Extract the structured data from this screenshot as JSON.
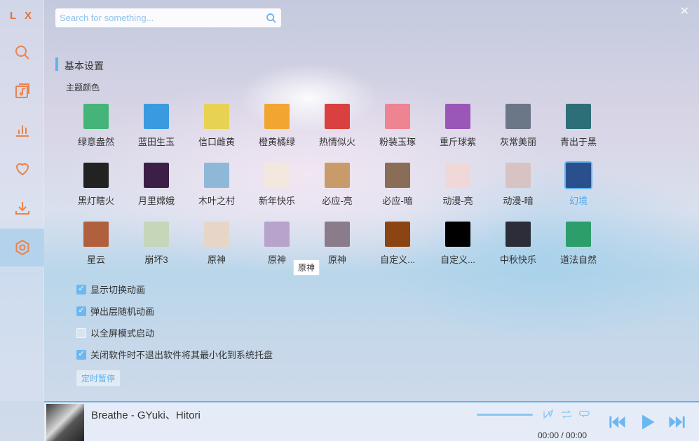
{
  "app": {
    "logo": "L X"
  },
  "sidebar": {
    "items": [
      {
        "name": "search",
        "icon": "search-icon"
      },
      {
        "name": "song-list",
        "icon": "music-list-icon"
      },
      {
        "name": "leaderboard",
        "icon": "chart-icon"
      },
      {
        "name": "favorites",
        "icon": "heart-icon"
      },
      {
        "name": "download",
        "icon": "download-icon"
      },
      {
        "name": "settings",
        "icon": "settings-icon",
        "active": true
      }
    ]
  },
  "search": {
    "placeholder": "Search for something..."
  },
  "settings": {
    "section_title": "基本设置",
    "theme_title": "主题颜色",
    "themes": [
      {
        "label": "绿意盎然",
        "color": "#45b479"
      },
      {
        "label": "蓝田生玉",
        "color": "#3a9ae0"
      },
      {
        "label": "信口雌黄",
        "color": "#e8d252"
      },
      {
        "label": "橙黄橘绿",
        "color": "#f3a532"
      },
      {
        "label": "热情似火",
        "color": "#d9403f"
      },
      {
        "label": "粉装玉琢",
        "color": "#ee8391"
      },
      {
        "label": "重斤球紫",
        "color": "#9a57b8"
      },
      {
        "label": "灰常美丽",
        "color": "#6b7686"
      },
      {
        "label": "青出于黑",
        "color": "#2e6e78"
      },
      {
        "label": "黑灯瞎火",
        "color": "#222222"
      },
      {
        "label": "月里嫦娥",
        "color": "#3b1f47"
      },
      {
        "label": "木叶之村",
        "color": "#8fb8d8"
      },
      {
        "label": "新年快乐",
        "color": "#f3e8de"
      },
      {
        "label": "必应-亮",
        "color": "#c99b6a"
      },
      {
        "label": "必应-暗",
        "color": "#8a6d57"
      },
      {
        "label": "动漫-亮",
        "color": "#f1d8d8"
      },
      {
        "label": "动漫-暗",
        "color": "#d8c3c3"
      },
      {
        "label": "幻境",
        "color": "#2a4f8d",
        "active": true
      },
      {
        "label": "星云",
        "color": "#b0603d"
      },
      {
        "label": "崩坏3",
        "color": "#c6d6b9"
      },
      {
        "label": "原神",
        "color": "#e7d6c8"
      },
      {
        "label": "原神",
        "color": "#b7a3cb"
      },
      {
        "label": "原神",
        "color": "#8a7c8a"
      },
      {
        "label": "自定义...",
        "color": "#8b4513"
      },
      {
        "label": "自定义...",
        "color": "#000000"
      },
      {
        "label": "中秋快乐",
        "color": "#2d2d3a"
      },
      {
        "label": "道法自然",
        "color": "#2d9d6b"
      }
    ],
    "tooltip": "原神",
    "options": [
      {
        "label": "显示切换动画",
        "checked": true
      },
      {
        "label": "弹出层随机动画",
        "checked": true
      },
      {
        "label": "以全屏模式启动",
        "checked": false
      },
      {
        "label": "关闭软件时不退出软件将其最小化到系统托盘",
        "checked": true
      }
    ],
    "timer_button": "定时暂停"
  },
  "player": {
    "song": "Breathe - GYuki、Hitori",
    "time": "00:00 / 00:00",
    "progress": 0,
    "accent": "#5fb1f0"
  }
}
